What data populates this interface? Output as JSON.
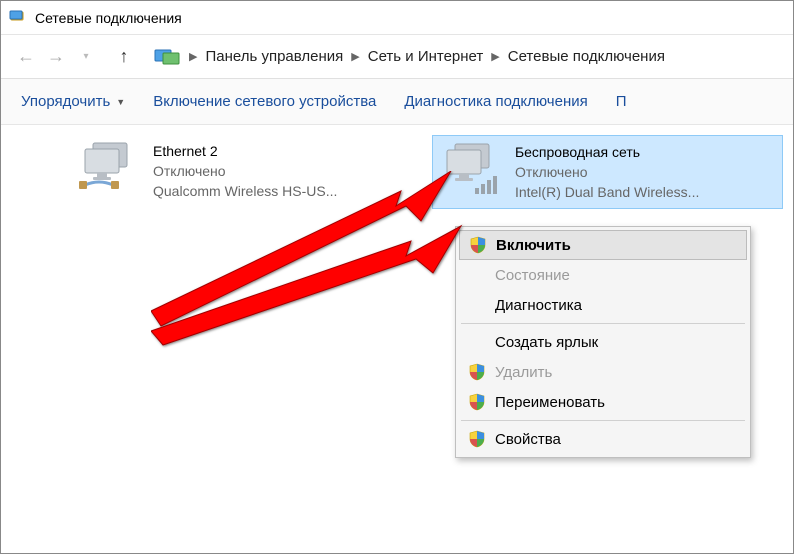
{
  "window": {
    "title": "Сетевые подключения"
  },
  "breadcrumbs": {
    "root": "Панель управления",
    "mid": "Сеть и Интернет",
    "leaf": "Сетевые подключения"
  },
  "toolbar": {
    "organize": "Упорядочить",
    "enable": "Включение сетевого устройства",
    "diag": "Диагностика подключения",
    "more": "П"
  },
  "adapters": [
    {
      "name": "Ethernet 2",
      "status": "Отключено",
      "desc": "Qualcomm Wireless HS-US..."
    },
    {
      "name": "Беспроводная сеть",
      "status": "Отключено",
      "desc": "Intel(R) Dual Band Wireless..."
    }
  ],
  "menu": {
    "enable": "Включить",
    "state": "Состояние",
    "diag": "Диагностика",
    "shortcut": "Создать ярлык",
    "delete": "Удалить",
    "rename": "Переименовать",
    "props": "Свойства"
  }
}
